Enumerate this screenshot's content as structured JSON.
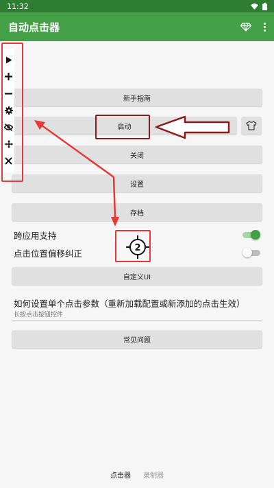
{
  "status_bar": {
    "time": "11:32",
    "icons": [
      "wifi-icon",
      "battery-icon"
    ]
  },
  "app_bar": {
    "title": "自动点击器",
    "actions": [
      "diamond-icon",
      "more-vert-icon"
    ]
  },
  "floating_toolbar": {
    "icons": [
      "play-icon",
      "plus-icon",
      "minus-icon",
      "gear-icon",
      "eye-off-icon",
      "move-icon",
      "close-icon"
    ]
  },
  "buttons": {
    "guide": "新手指南",
    "start": "启动",
    "close": "关闭",
    "settings": "设置",
    "archive": "存档",
    "custom_ui": "自定义UI",
    "faq": "常见问题"
  },
  "settings": {
    "cross_app": {
      "label": "跨应用支持",
      "enabled": true
    },
    "offset_correction": {
      "label": "点击位置偏移纠正",
      "enabled": false
    }
  },
  "click_target": {
    "number": "2"
  },
  "info": {
    "title": "如何设置单个点击参数（重新加载配置或新添加的点击生效）",
    "subtitle": "长按点击按钮控件"
  },
  "bottom_nav": {
    "items": [
      {
        "label": "点击器",
        "active": true
      },
      {
        "label": "录制器",
        "active": false
      }
    ]
  },
  "colors": {
    "primary": "#43a047",
    "status_bar": "#2e7d32",
    "annotation_red": "#e53935",
    "annotation_dark": "#8b1a1a"
  }
}
